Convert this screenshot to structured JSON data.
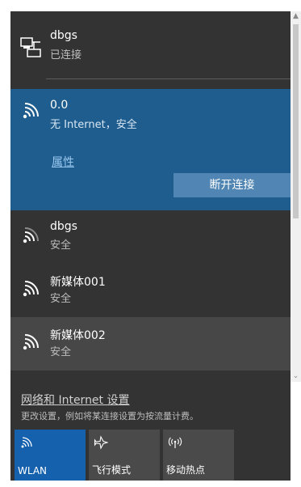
{
  "ethernet": {
    "name": "dbgs",
    "status": "已连接",
    "icon": "ethernet-icon"
  },
  "selected_network": {
    "name": "0.0",
    "status": "无 Internet，安全",
    "properties_label": "属性",
    "disconnect_label": "断开连接",
    "icon": "wifi-icon"
  },
  "networks": [
    {
      "name": "dbgs",
      "status": "安全",
      "icon": "wifi-icon"
    },
    {
      "name": "新媒体001",
      "status": "安全",
      "icon": "wifi-icon"
    },
    {
      "name": "新媒体002",
      "status": "安全",
      "icon": "wifi-icon"
    }
  ],
  "settings": {
    "link": "网络和 Internet 设置",
    "description": "更改设置，例如将某连接设置为按流量计费。"
  },
  "quick_actions": [
    {
      "label": "WLAN",
      "active": true,
      "icon": "wifi-icon"
    },
    {
      "label": "飞行模式",
      "active": false,
      "icon": "airplane-icon"
    },
    {
      "label": "移动热点",
      "active": false,
      "icon": "hotspot-icon"
    }
  ],
  "colors": {
    "flyout_background": "#333333",
    "selected_background": "#1f5d8f",
    "button_background": "#5186b4",
    "active_tile": "#1561ae",
    "link": "#99c8ef"
  }
}
